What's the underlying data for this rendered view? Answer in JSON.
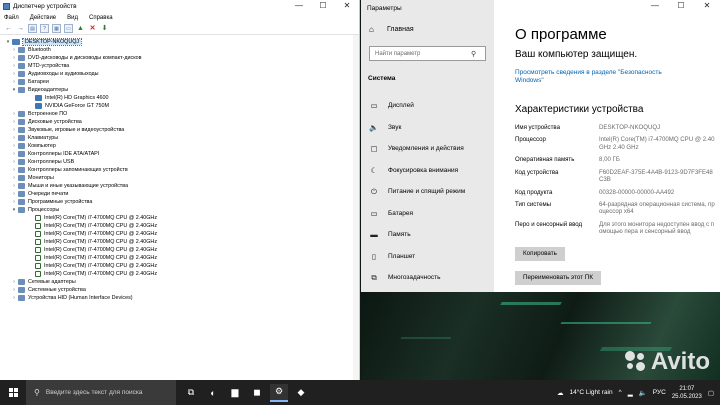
{
  "device_manager": {
    "title": "Диспетчер устройств",
    "window_buttons": [
      "—",
      "☐",
      "✕"
    ],
    "menu": [
      "Файл",
      "Действие",
      "Вид",
      "Справка"
    ],
    "tree": [
      {
        "level": 0,
        "arrow": "▾",
        "label": "DESKTOP-NKOQUQJ",
        "icon": "computer-icon",
        "selected": true
      },
      {
        "level": 1,
        "arrow": "›",
        "label": "Bluetooth",
        "icon": "bluetooth-icon"
      },
      {
        "level": 1,
        "arrow": "›",
        "label": "DVD-дисководы и дисководы компакт-дисков",
        "icon": "dvd-icon"
      },
      {
        "level": 1,
        "arrow": "›",
        "label": "MTD-устройства",
        "icon": "mtd-icon"
      },
      {
        "level": 1,
        "arrow": "›",
        "label": "Аудиовходы и аудиовыходы",
        "icon": "audio-icon"
      },
      {
        "level": 1,
        "arrow": "›",
        "label": "Батареи",
        "icon": "battery-icon"
      },
      {
        "level": 1,
        "arrow": "▾",
        "label": "Видеоадаптеры",
        "icon": "display-adapter-icon"
      },
      {
        "level": 2,
        "arrow": "",
        "label": "Intel(R) HD Graphics 4600",
        "icon": "gpu-icon"
      },
      {
        "level": 2,
        "arrow": "",
        "label": "NVIDIA GeForce GT 750M",
        "icon": "gpu-icon"
      },
      {
        "level": 1,
        "arrow": "›",
        "label": "Встроенное ПО",
        "icon": "firmware-icon"
      },
      {
        "level": 1,
        "arrow": "›",
        "label": "Дисковые устройства",
        "icon": "disk-icon"
      },
      {
        "level": 1,
        "arrow": "›",
        "label": "Звуковые, игровые и видеоустройства",
        "icon": "sound-icon"
      },
      {
        "level": 1,
        "arrow": "›",
        "label": "Клавиатуры",
        "icon": "keyboard-icon"
      },
      {
        "level": 1,
        "arrow": "›",
        "label": "Компьютер",
        "icon": "computer-icon"
      },
      {
        "level": 1,
        "arrow": "›",
        "label": "Контроллеры IDE ATA/ATAPI",
        "icon": "ide-icon"
      },
      {
        "level": 1,
        "arrow": "›",
        "label": "Контроллеры USB",
        "icon": "usb-icon"
      },
      {
        "level": 1,
        "arrow": "›",
        "label": "Контроллеры запоминающих устройств",
        "icon": "storage-icon"
      },
      {
        "level": 1,
        "arrow": "›",
        "label": "Мониторы",
        "icon": "monitor-icon"
      },
      {
        "level": 1,
        "arrow": "›",
        "label": "Мыши и иные указывающие устройства",
        "icon": "mouse-icon"
      },
      {
        "level": 1,
        "arrow": "›",
        "label": "Очереди печати",
        "icon": "printer-icon"
      },
      {
        "level": 1,
        "arrow": "›",
        "label": "Программные устройства",
        "icon": "software-device-icon"
      },
      {
        "level": 1,
        "arrow": "▾",
        "label": "Процессоры",
        "icon": "processor-icon"
      },
      {
        "level": 2,
        "arrow": "",
        "label": "Intel(R) Core(TM) i7-4700MQ CPU @ 2.40GHz",
        "icon": "cpu-icon"
      },
      {
        "level": 2,
        "arrow": "",
        "label": "Intel(R) Core(TM) i7-4700MQ CPU @ 2.40GHz",
        "icon": "cpu-icon"
      },
      {
        "level": 2,
        "arrow": "",
        "label": "Intel(R) Core(TM) i7-4700MQ CPU @ 2.40GHz",
        "icon": "cpu-icon"
      },
      {
        "level": 2,
        "arrow": "",
        "label": "Intel(R) Core(TM) i7-4700MQ CPU @ 2.40GHz",
        "icon": "cpu-icon"
      },
      {
        "level": 2,
        "arrow": "",
        "label": "Intel(R) Core(TM) i7-4700MQ CPU @ 2.40GHz",
        "icon": "cpu-icon"
      },
      {
        "level": 2,
        "arrow": "",
        "label": "Intel(R) Core(TM) i7-4700MQ CPU @ 2.40GHz",
        "icon": "cpu-icon"
      },
      {
        "level": 2,
        "arrow": "",
        "label": "Intel(R) Core(TM) i7-4700MQ CPU @ 2.40GHz",
        "icon": "cpu-icon"
      },
      {
        "level": 2,
        "arrow": "",
        "label": "Intel(R) Core(TM) i7-4700MQ CPU @ 2.40GHz",
        "icon": "cpu-icon"
      },
      {
        "level": 1,
        "arrow": "›",
        "label": "Сетевые адаптеры",
        "icon": "network-adapter-icon"
      },
      {
        "level": 1,
        "arrow": "›",
        "label": "Системные устройства",
        "icon": "system-device-icon"
      },
      {
        "level": 1,
        "arrow": "›",
        "label": "Устройства HID (Human Interface Devices)",
        "icon": "hid-icon"
      }
    ]
  },
  "settings": {
    "app_title": "Параметры",
    "window_buttons": [
      "—",
      "☐",
      "✕"
    ],
    "home_label": "Главная",
    "search_placeholder": "Найти параметр",
    "section_label": "Система",
    "nav_items": [
      {
        "label": "Дисплей",
        "icon": "display-icon",
        "glyph": "▭"
      },
      {
        "label": "Звук",
        "icon": "sound-icon",
        "glyph": "🔈"
      },
      {
        "label": "Уведомления и действия",
        "icon": "notifications-icon",
        "glyph": "▢"
      },
      {
        "label": "Фокусировка внимания",
        "icon": "focus-assist-icon",
        "glyph": "☾"
      },
      {
        "label": "Питание и спящий режим",
        "icon": "power-icon",
        "glyph": "⏻"
      },
      {
        "label": "Батарея",
        "icon": "battery-icon",
        "glyph": "▭"
      },
      {
        "label": "Память",
        "icon": "storage-icon",
        "glyph": "▬"
      },
      {
        "label": "Планшет",
        "icon": "tablet-icon",
        "glyph": "▯"
      },
      {
        "label": "Многозадачность",
        "icon": "multitasking-icon",
        "glyph": "⧉"
      }
    ],
    "page_title": "О программе",
    "protected_text": "Ваш компьютер защищен.",
    "security_link": "Просмотреть сведения в разделе \"Безопасность Windows\"",
    "specs_title": "Характеристики устройства",
    "specs": [
      {
        "key": "Имя устройства",
        "value": "DESKTOP-NKOQUQJ"
      },
      {
        "key": "Процессор",
        "value": "Intel(R) Core(TM) i7-4700MQ CPU @ 2.40GHz   2.40 GHz"
      },
      {
        "key": "Оперативная память",
        "value": "8,00 ГБ"
      },
      {
        "key": "Код устройства",
        "value": "F60D2EAF-375E-4A4B-9123-9D7F3FE48C3B"
      },
      {
        "key": "Код продукта",
        "value": "00328-00000-00000-AA492"
      },
      {
        "key": "Тип системы",
        "value": "64-разрядная операционная система, процессор x64"
      },
      {
        "key": "Перо и сенсорный ввод",
        "value": "Для этого монитора недоступен ввод с помощью пера и сенсорный ввод"
      }
    ],
    "copy_button": "Копировать",
    "rename_button": "Переименовать этот ПК"
  },
  "desktop": {
    "watermark": "Avito"
  },
  "taskbar": {
    "search_placeholder": "Введите здесь текст для поиска",
    "apps": [
      {
        "name": "task-view-icon",
        "glyph": "⧉"
      },
      {
        "name": "edge-icon",
        "glyph": "◐"
      },
      {
        "name": "file-explorer-icon",
        "glyph": "▆"
      },
      {
        "name": "store-icon",
        "glyph": "◼"
      },
      {
        "name": "settings-icon",
        "glyph": "⚙"
      },
      {
        "name": "app-icon",
        "glyph": "◆"
      }
    ],
    "weather": "14°C  Light rain",
    "language": "РУС",
    "time": "21:07",
    "date": "25.05.2023"
  }
}
